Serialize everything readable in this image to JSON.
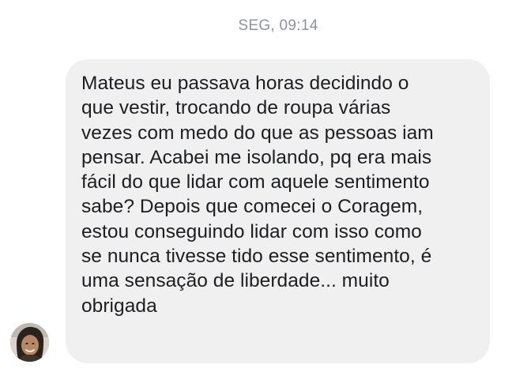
{
  "header": {
    "timestamp": "SEG, 09:14"
  },
  "message": {
    "text": "Mateus eu passava horas decidindo o\nque vestir, trocando de roupa várias\nvezes com medo do que as pessoas iam\npensar. Acabei me isolando, pq era mais\nfácil do que lidar com aquele sentimento\nsabe? Depois que comecei o Coragem,\nestou conseguindo lidar com isso como\nse nunca tivesse tido esse sentimento, é\numa sensação de liberdade... muito\nobrigada"
  },
  "sender": {
    "avatar_icon": "user-avatar-photo"
  },
  "colors": {
    "bubble_background": "#f1f0f0",
    "message_text": "#1c1e21",
    "timestamp_text": "#8d949e"
  }
}
